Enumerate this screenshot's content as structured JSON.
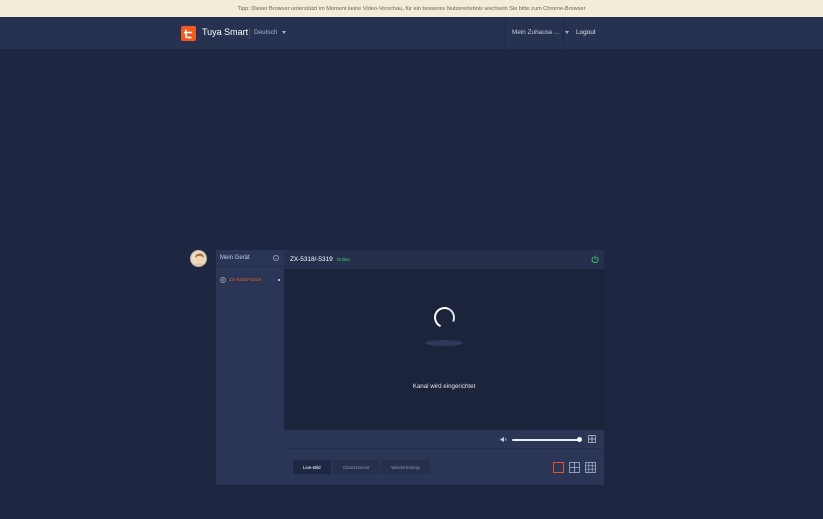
{
  "tip": "Tipp: Dieser Browser unterstützt im Moment keine Video-Vorschau, für ein besseres Nutzererlebnis wechseln Sie bitte zum Chrome-Browser",
  "header": {
    "brand": "Tuya Smart",
    "language": "Deutsch",
    "home": "Mein Zuhause ...",
    "logout": "Logout"
  },
  "sidebar": {
    "title": "Mein Gerät",
    "devices": [
      {
        "name": "ZX-5318/-5319",
        "color": "#f25a22"
      }
    ]
  },
  "camera": {
    "title": "ZX-5318/-5319",
    "online": "Online",
    "status": "Kanal wird eingerichtet",
    "volume": 0.95
  },
  "tabs": [
    {
      "label": "Live-Bild",
      "active": true
    },
    {
      "label": "Cloud-Dienst",
      "active": false
    },
    {
      "label": "Wiederholung",
      "active": false
    }
  ],
  "colors": {
    "accent": "#f25a22",
    "online": "#3fd16a",
    "background": "#1e2742"
  },
  "icons": [
    "tuya-logo-icon",
    "chevron-down-icon",
    "settings-icon",
    "camera-icon",
    "power-icon",
    "speaker-icon",
    "fullscreen-icon",
    "layout-1-icon",
    "layout-4-icon",
    "layout-9-icon"
  ]
}
